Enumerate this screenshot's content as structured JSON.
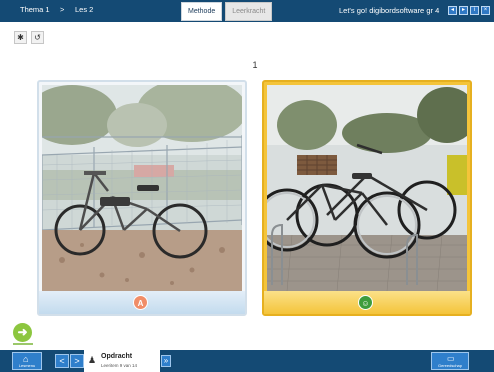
{
  "header": {
    "thema": "Thema 1",
    "separator": ">",
    "les": "Les 2",
    "tabs": [
      {
        "label": "Methode"
      },
      {
        "label": "Leerkracht"
      }
    ],
    "app_title": "Let's go! digibordsoftware gr 4",
    "window_buttons": [
      "prev-icon",
      "next-icon",
      "info-icon",
      "close-icon"
    ]
  },
  "toolbar": {
    "items": [
      "gear-icon",
      "reset-icon"
    ]
  },
  "page": {
    "number": "1"
  },
  "cards": [
    {
      "badge": "A",
      "state": "neutral",
      "photo": "bicycle-leaning-on-fence"
    },
    {
      "badge": "☺",
      "state": "selected",
      "photo": "bicycles-in-rack"
    }
  ],
  "bottom": {
    "home_label": "Lesmenu",
    "prev_arrow": "<",
    "next_arrow": ">",
    "opdracht_title": "Opdracht",
    "opdracht_sub": "Leeritem 9 van 14",
    "expand_arrow": "»",
    "right_label": "Gereedschap"
  },
  "colors": {
    "bar": "#144a74",
    "button_blue": "#2f7fcb",
    "selected_yellow": "#f4c43a",
    "badge_orange": "#f08d68",
    "badge_green": "#3f9c3c",
    "go_green": "#8cc63f"
  }
}
